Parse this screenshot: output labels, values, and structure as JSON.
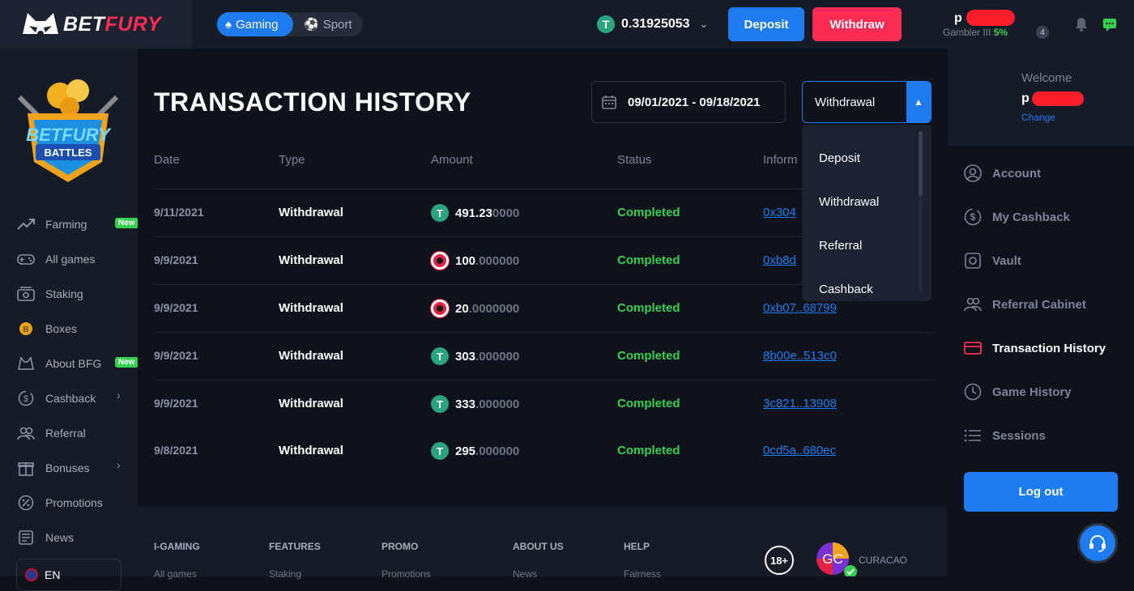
{
  "brand": {
    "name_b": "BET",
    "name_f": "FURY",
    "accent": "#ff2c55",
    "primary": "#1e7bf0",
    "success": "#36d04f"
  },
  "header": {
    "mode_gaming": "Gaming",
    "mode_sport": "Sport",
    "balance": "0.31925053",
    "deposit_label": "Deposit",
    "withdraw_label": "Withdraw",
    "user_name_visible": "p",
    "user_level": "Gambler III",
    "user_level_pct": "5%",
    "level_badge": "4"
  },
  "sidebar": {
    "promo_alt": "BETFURY BATTLES",
    "items": [
      {
        "label": "Farming",
        "icon": "chart-up-icon",
        "badge": "New"
      },
      {
        "label": "All games",
        "icon": "gamepad-icon"
      },
      {
        "label": "Staking",
        "icon": "staking-icon"
      },
      {
        "label": "Boxes",
        "icon": "coin-icon"
      },
      {
        "label": "About BFG",
        "icon": "bfg-icon",
        "badge": "New"
      },
      {
        "label": "Cashback",
        "icon": "cashback-icon",
        "has_arrow": true
      },
      {
        "label": "Referral",
        "icon": "referral-icon"
      },
      {
        "label": "Bonuses",
        "icon": "gift-icon",
        "has_arrow": true
      },
      {
        "label": "Promotions",
        "icon": "percent-icon"
      },
      {
        "label": "News",
        "icon": "news-icon"
      }
    ],
    "language": "EN"
  },
  "main": {
    "title": "TRANSACTION HISTORY",
    "date_range": "09/01/2021 - 09/18/2021",
    "type_selected": "Withdrawal",
    "dropdown_options": [
      "Deposit",
      "Withdrawal",
      "Referral",
      "Cashback"
    ],
    "columns": [
      "Date",
      "Type",
      "Amount",
      "Status",
      "Inform"
    ],
    "rows": [
      {
        "date": "9/11/2021",
        "type": "Withdrawal",
        "coin": "usdt",
        "amount_int": "491.23",
        "amount_dec": "0000",
        "status": "Completed",
        "info": "0x304"
      },
      {
        "date": "9/9/2021",
        "type": "Withdrawal",
        "coin": "bfg",
        "amount_int": "100",
        "amount_dec": ".000000",
        "status": "Completed",
        "info": "0xb8d"
      },
      {
        "date": "9/9/2021",
        "type": "Withdrawal",
        "coin": "bfg",
        "amount_int": "20",
        "amount_dec": ".0000000",
        "status": "Completed",
        "info": "0xb07..68799"
      },
      {
        "date": "9/9/2021",
        "type": "Withdrawal",
        "coin": "usdt",
        "amount_int": "303",
        "amount_dec": ".000000",
        "status": "Completed",
        "info": "8b00e..513c0"
      },
      {
        "date": "9/9/2021",
        "type": "Withdrawal",
        "coin": "usdt",
        "amount_int": "333",
        "amount_dec": ".000000",
        "status": "Completed",
        "info": "3c821..13908"
      },
      {
        "date": "9/8/2021",
        "type": "Withdrawal",
        "coin": "usdt",
        "amount_int": "295",
        "amount_dec": ".000000",
        "status": "Completed",
        "info": "0cd5a..680ec"
      }
    ]
  },
  "footer": {
    "columns": [
      {
        "head": "I-GAMING",
        "link": "All games"
      },
      {
        "head": "FEATURES",
        "link": "Staking"
      },
      {
        "head": "PROMO",
        "link": "Promotions"
      },
      {
        "head": "ABOUT US",
        "link": "News"
      },
      {
        "head": "HELP",
        "link": "Fairness"
      }
    ],
    "age": "18+",
    "license": "CURACAO"
  },
  "right": {
    "welcome": "Welcome",
    "name_visible": "p",
    "change": "Change",
    "items": [
      {
        "label": "Account",
        "icon": "user-icon"
      },
      {
        "label": "My Cashback",
        "icon": "cashback-icon"
      },
      {
        "label": "Vault",
        "icon": "vault-icon"
      },
      {
        "label": "Referral Cabinet",
        "icon": "referral-icon"
      },
      {
        "label": "Transaction History",
        "icon": "card-icon",
        "active": true
      },
      {
        "label": "Game History",
        "icon": "clock-icon"
      },
      {
        "label": "Sessions",
        "icon": "list-icon"
      }
    ],
    "logout": "Log out"
  }
}
